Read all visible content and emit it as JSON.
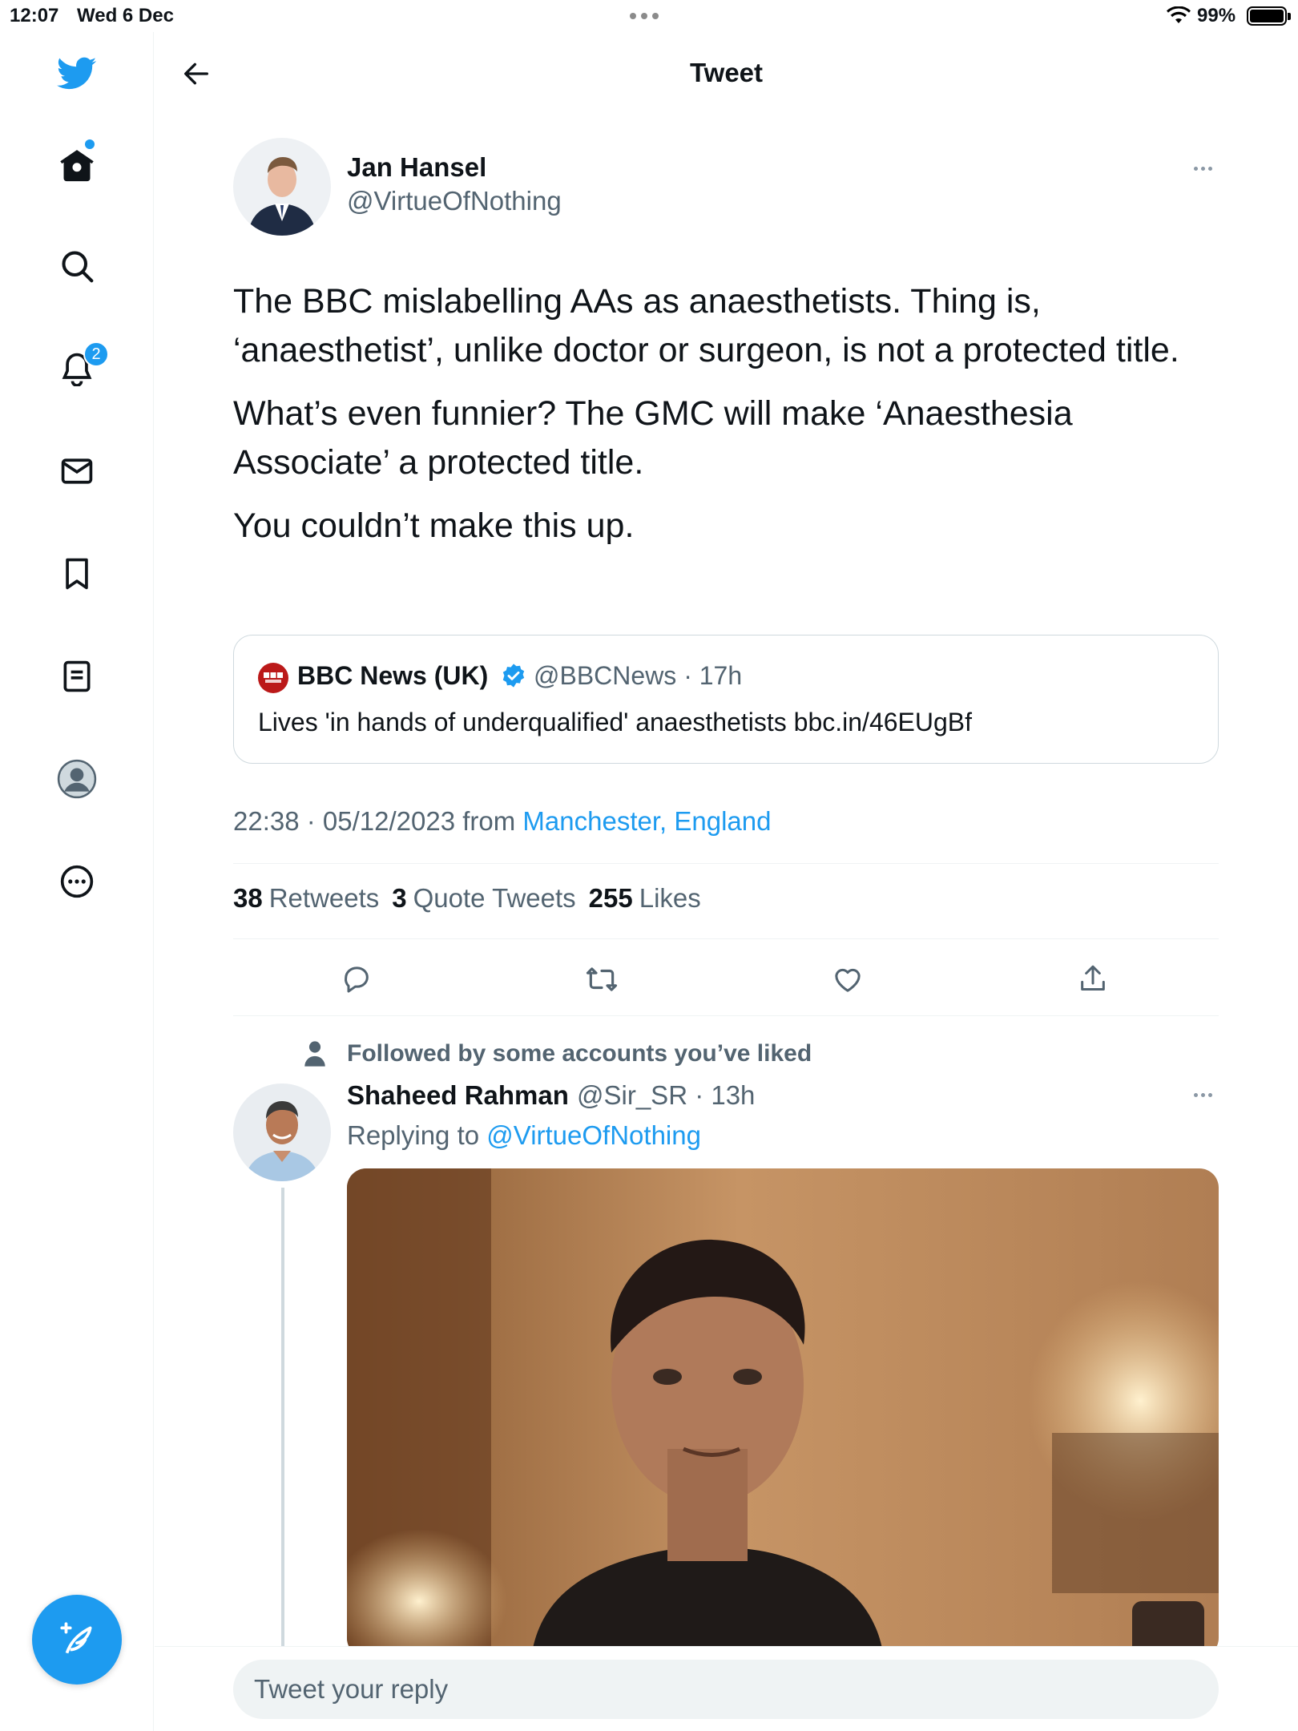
{
  "status_bar": {
    "time": "12:07",
    "date": "Wed 6 Dec",
    "battery": "99%"
  },
  "sidebar": {
    "notification_count": "2",
    "items": [
      "twitter-logo",
      "home-icon",
      "search-icon",
      "bell-icon",
      "mail-icon",
      "bookmark-icon",
      "lists-icon",
      "profile-icon",
      "more-icon"
    ]
  },
  "header": {
    "title": "Tweet"
  },
  "tweet": {
    "author_name": "Jan Hansel",
    "author_handle": "@VirtueOfNothing",
    "paragraphs": [
      "The BBC mislabelling AAs as anaesthetists. Thing is, ‘anaesthetist’, unlike doctor or surgeon, is not a protected title.",
      "What’s even funnier? The GMC will make ‘Anaesthesia Associate’ a protected title.",
      "You couldn’t make this up."
    ],
    "quote": {
      "name": "BBC News (UK)",
      "handle_time": "@BBCNews · 17h",
      "text": "Lives 'in hands of underqualified' anaesthetists bbc.in/46EUgBf"
    },
    "timestamp": "22:38 · 05/12/2023",
    "from_label": "from",
    "location": "Manchester, England",
    "stats": {
      "retweets_count": "38",
      "retweets_label": "Retweets",
      "quotes_count": "3",
      "quotes_label": "Quote Tweets",
      "likes_count": "255",
      "likes_label": "Likes"
    }
  },
  "reply": {
    "social_context": "Followed by some accounts you’ve liked",
    "author_name": "Shaheed Rahman",
    "handle_time": "@Sir_SR · 13h",
    "replying_label": "Replying to",
    "replying_to": "@VirtueOfNothing"
  },
  "composer": {
    "placeholder": "Tweet your reply"
  },
  "colors": {
    "accent": "#1d9bf0",
    "text": "#0f1419",
    "secondary": "#536471",
    "border": "#eff3f4"
  }
}
